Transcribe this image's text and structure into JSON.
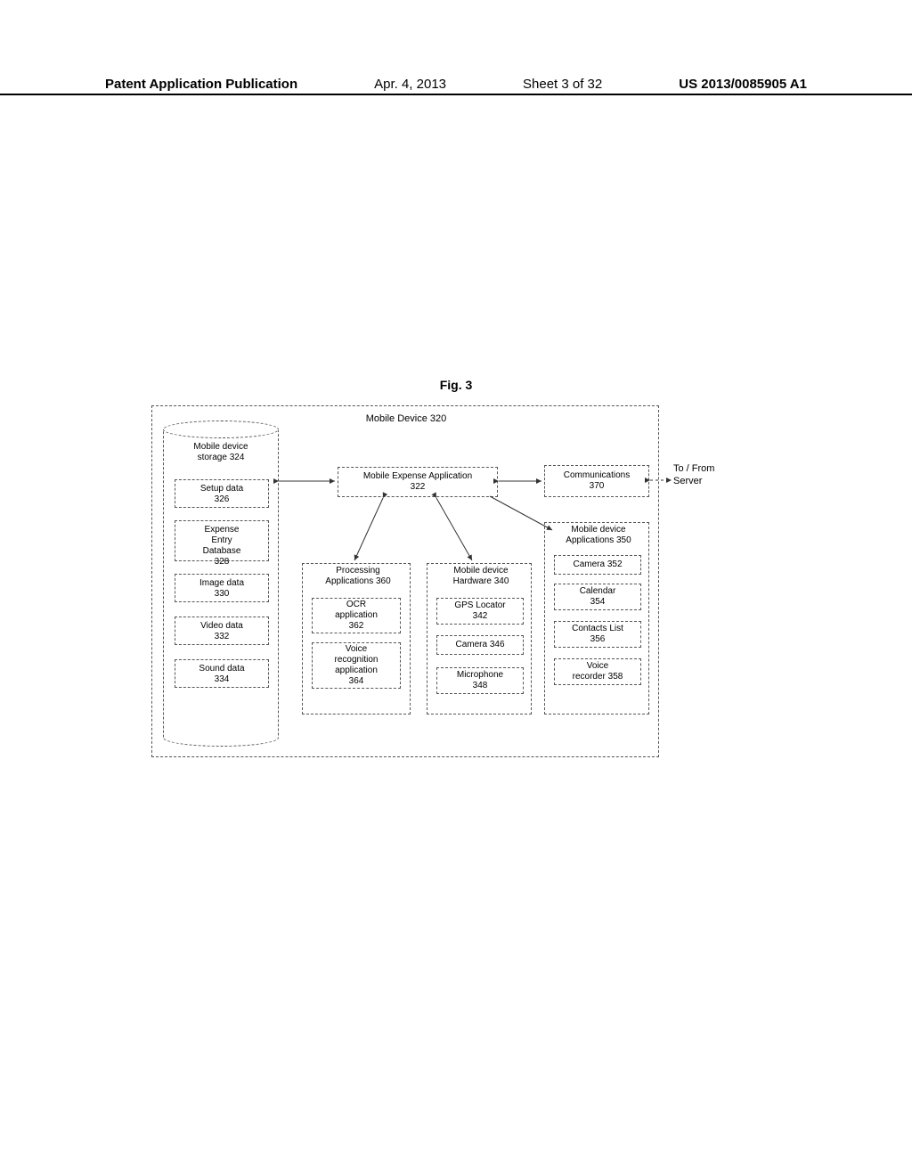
{
  "header": {
    "publication_label": "Patent Application Publication",
    "date": "Apr. 4, 2013",
    "sheet": "Sheet 3 of 32",
    "pub_number": "US 2013/0085905 A1"
  },
  "figure_title": "Fig. 3",
  "device_title": "Mobile Device 320",
  "storage": {
    "title": "Mobile device\nstorage 324",
    "items": {
      "setup": "Setup data\n326",
      "expense_db": "Expense\nEntry\nDatabase\n328",
      "image": "Image data\n330",
      "video": "Video data\n332",
      "sound": "Sound data\n334"
    }
  },
  "app_box": "Mobile Expense Application\n322",
  "processing": {
    "title": "Processing\nApplications 360",
    "ocr": "OCR\napplication\n362",
    "voice": "Voice\nrecognition\napplication\n364"
  },
  "hardware": {
    "title": "Mobile device\nHardware 340",
    "gps": "GPS Locator\n342",
    "camera": "Camera 346",
    "mic": "Microphone\n348"
  },
  "applications": {
    "title": "Mobile device\nApplications 350",
    "camera": "Camera 352",
    "calendar": "Calendar\n354",
    "contacts": "Contacts List\n356",
    "voice": "Voice\nrecorder 358"
  },
  "communications": "Communications\n370",
  "external_label": "To / From\nServer"
}
